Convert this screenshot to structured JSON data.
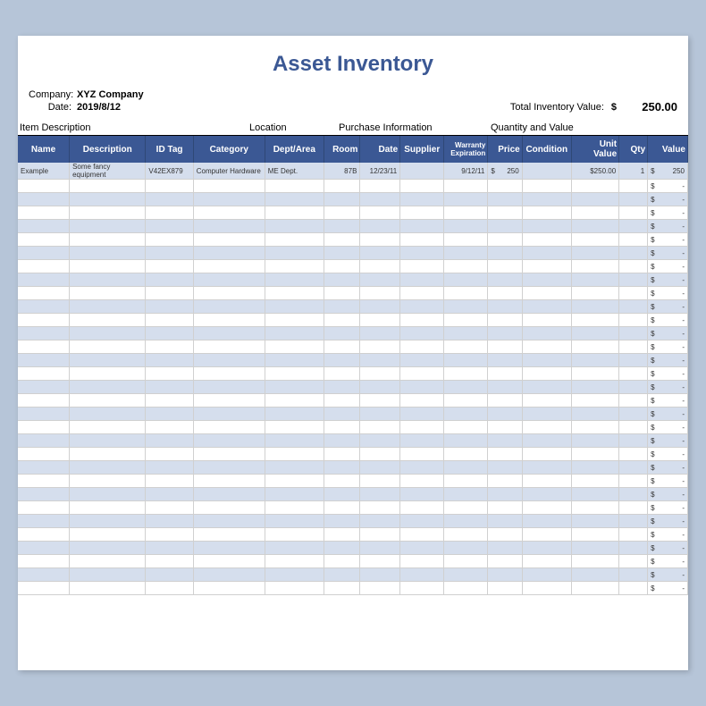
{
  "title": "Asset Inventory",
  "company_label": "Company:",
  "company_value": "XYZ Company",
  "date_label": "Date:",
  "date_value": "2019/8/12",
  "total_label": "Total Inventory Value:",
  "total_currency": "$",
  "total_value": "250.00",
  "sections": {
    "item": "Item Description",
    "location": "Location",
    "purchase": "Purchase Information",
    "quantity": "Quantity and Value"
  },
  "headers": {
    "name": "Name",
    "description": "Description",
    "id_tag": "ID Tag",
    "category": "Category",
    "dept": "Dept/Area",
    "room": "Room",
    "date": "Date",
    "supplier": "Supplier",
    "warranty": "Warranty Expiration",
    "price": "Price",
    "condition": "Condition",
    "unit_value": "Unit Value",
    "qty": "Qty",
    "value": "Value"
  },
  "row1": {
    "name": "Example",
    "description": "Some fancy equipment",
    "id_tag": "V42EX879",
    "category": "Computer Hardware",
    "dept": "ME Dept.",
    "room": "87B",
    "date": "12/23/11",
    "supplier": "",
    "warranty": "9/12/11",
    "price_cur": "$",
    "price": "250",
    "condition": "",
    "unit_value": "$250.00",
    "qty": "1",
    "value_cur": "$",
    "value": "250"
  },
  "empty_value_cur": "$",
  "empty_value_dash": "-",
  "empty_row_count": 31
}
